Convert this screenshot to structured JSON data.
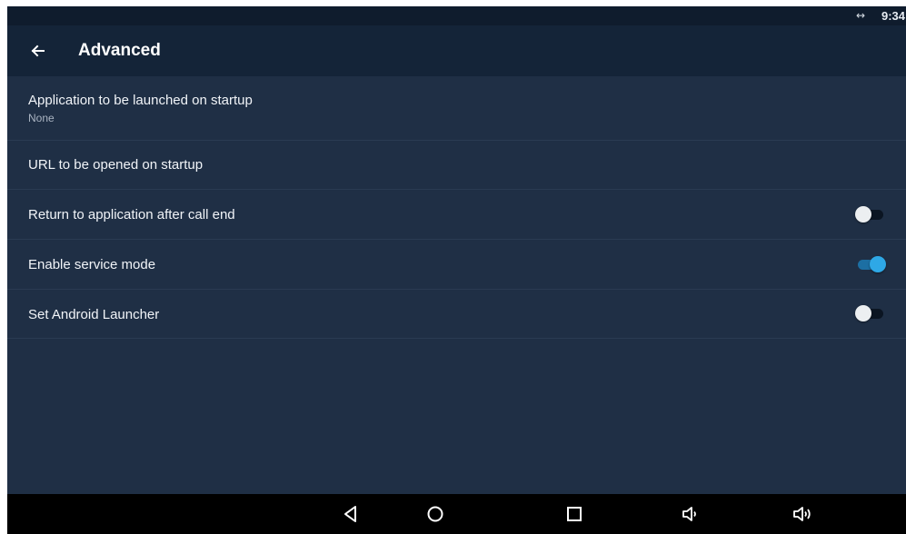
{
  "status_bar": {
    "connection_icon": "data-transfer-arrows-icon",
    "connection_glyph": "↔",
    "time": "9:34"
  },
  "app_bar": {
    "back_icon": "arrow-left-icon",
    "title": "Advanced"
  },
  "settings": {
    "items": [
      {
        "title": "Application to be launched on startup",
        "subtitle": "None"
      },
      {
        "title": "URL to be opened on startup"
      },
      {
        "title": "Return to application after call end",
        "toggle": false
      },
      {
        "title": "Enable service mode",
        "toggle": true
      },
      {
        "title": "Set Android Launcher",
        "toggle": false
      }
    ]
  },
  "nav_bar": {
    "buttons": [
      "back-triangle-icon",
      "home-circle-icon",
      "recents-square-icon",
      "volume-down-icon",
      "volume-up-icon"
    ]
  },
  "colors": {
    "background": "#1f2f45",
    "app_bar": "#142438",
    "status_bar": "#0f1c2d",
    "accent": "#2ea8e6",
    "toggle_on_track": "#1c6fa3",
    "toggle_off_thumb": "#eceff1",
    "toggle_off_track": "#0b1522",
    "nav_bar": "#000000"
  }
}
